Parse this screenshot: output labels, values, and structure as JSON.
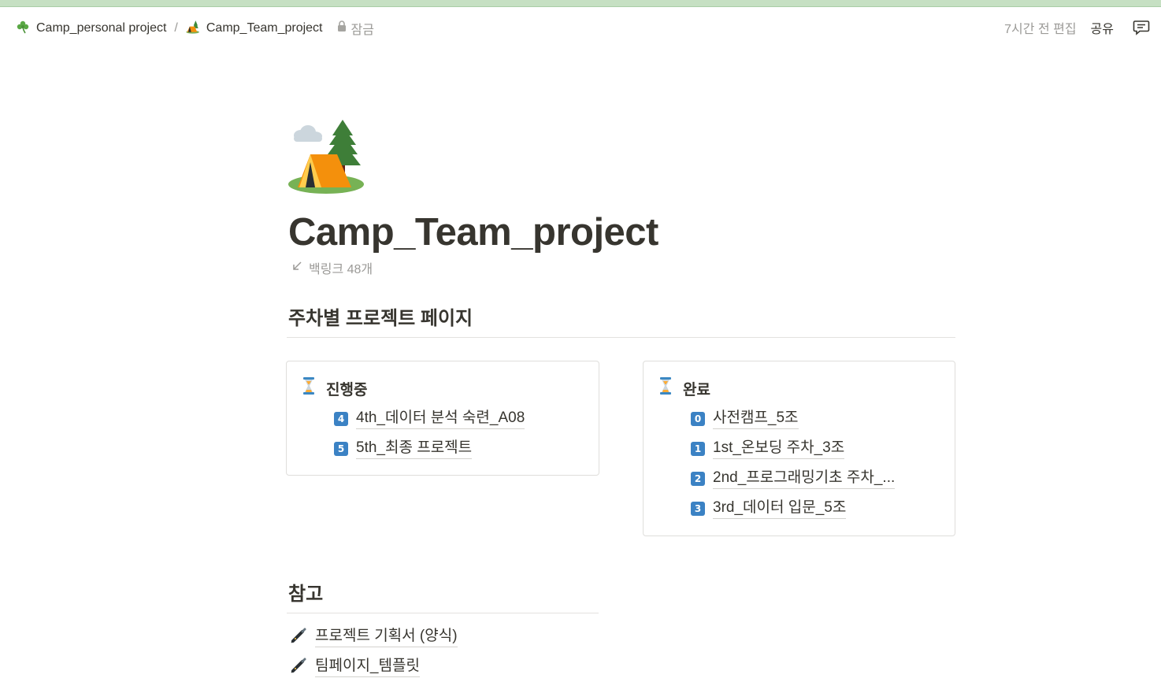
{
  "breadcrumb": {
    "items": [
      {
        "label": "Camp_personal project",
        "icon": "shamrock-icon"
      },
      {
        "label": "Camp_Team_project",
        "icon": "camping-icon"
      }
    ],
    "separator": "/",
    "lock_label": "잠금"
  },
  "topbar": {
    "edited": "7시간 전 편집",
    "share_label": "공유"
  },
  "page": {
    "icon": "camping-icon",
    "title": "Camp_Team_project",
    "backlinks": "백링크 48개"
  },
  "weekly": {
    "heading": "주차별 프로젝트 페이지",
    "in_progress": {
      "title": "진행중",
      "icon": "hourglass-icon",
      "items": [
        {
          "num": "4",
          "label": "4th_데이터 분석 숙련_A08"
        },
        {
          "num": "5",
          "label": "5th_최종 프로젝트"
        }
      ]
    },
    "done": {
      "title": "완료",
      "icon": "hourglass-icon",
      "items": [
        {
          "num": "0",
          "label": "사전캠프_5조"
        },
        {
          "num": "1",
          "label": "1st_온보딩 주차_3조"
        },
        {
          "num": "2",
          "label": "2nd_프로그래밍기초 주차_..."
        },
        {
          "num": "3",
          "label": "3rd_데이터 입문_5조"
        }
      ]
    }
  },
  "reference": {
    "heading": "참고",
    "items": [
      {
        "label": "프로젝트 기획서 (양식)",
        "icon": "pen-icon"
      },
      {
        "label": "팀페이지_템플릿",
        "icon": "pen-icon"
      }
    ]
  },
  "colors": {
    "number_badge": "#3b82c4",
    "top_strip": "#c6e0c3",
    "text": "#37352f",
    "muted": "#9b9a97"
  }
}
